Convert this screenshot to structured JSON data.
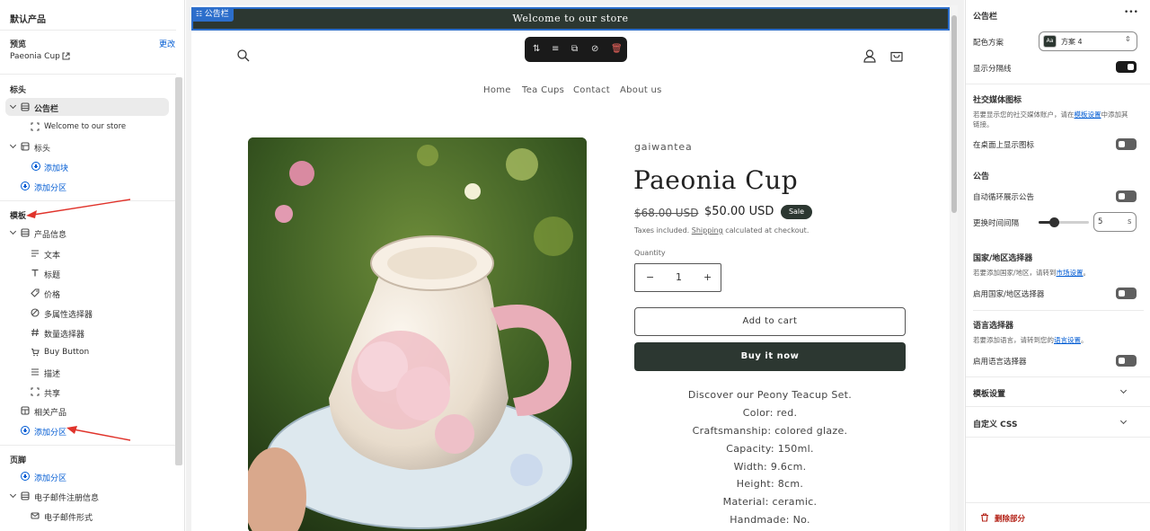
{
  "left": {
    "default_product": "默认产品",
    "preview_label": "预览",
    "change_link": "更改",
    "product_name": "Paeonia Cup",
    "header_section": "标头",
    "announcement_bar": "公告栏",
    "announcement_item": "Welcome to our store",
    "header_item": "标头",
    "add_block": "添加块",
    "add_section": "添加分区",
    "template_section": "模板",
    "product_info": "产品信息",
    "blocks": [
      "文本",
      "标题",
      "价格",
      "多属性选择器",
      "数量选择器",
      "Buy Button",
      "描述",
      "共享"
    ],
    "related_products": "相关产品",
    "add_section_2": "添加分区",
    "footer_section": "页脚",
    "add_section_3": "添加分区",
    "email_signup": "电子邮件注册信息",
    "email_form": "电子邮件形式"
  },
  "preview": {
    "announcement_tag": "公告栏",
    "announcement_text": "Welcome to our store",
    "nav": [
      "Home",
      "Tea Cups",
      "Contact",
      "About us"
    ],
    "vendor": "gaiwantea",
    "title": "Paeonia Cup",
    "old_price": "$68.00 USD",
    "new_price": "$50.00 USD",
    "sale_badge": "Sale",
    "taxes_prefix": "Taxes included.",
    "shipping_link": "Shipping",
    "taxes_suffix": "calculated at checkout.",
    "quantity_label": "Quantity",
    "quantity_value": "1",
    "add_to_cart": "Add to cart",
    "buy_now": "Buy it now",
    "description": [
      "Discover our Peony Teacup Set.",
      "Color: red.",
      "Craftsmanship: colored glaze.",
      "Capacity: 150ml.",
      "Width: 9.6cm.",
      "Height: 8cm.",
      "Material: ceramic.",
      "Handmade: No."
    ]
  },
  "right": {
    "title": "公告栏",
    "more": "•••",
    "color_scheme_label": "配色方案",
    "color_scheme_value": "方案 4",
    "swatch_text": "Aa",
    "show_divider": "显示分隔线",
    "social_heading": "社交媒体图标",
    "social_help_1": "若要显示您的社交媒体账户，请在",
    "social_help_link": "模板设置",
    "social_help_2": "中添加其",
    "social_help_3": "链接。",
    "show_on_desktop": "在桌面上显示图标",
    "announcement_heading": "公告",
    "auto_rotate": "自动循环展示公告",
    "change_interval": "更换时间间隔",
    "interval_value": "5",
    "interval_unit": "s",
    "interval_fraction": 0.3,
    "country_heading": "国家/地区选择器",
    "country_help": "若要添加国家/地区，请转到",
    "country_help_link": "市场设置",
    "country_help_end": "。",
    "enable_country": "启用国家/地区选择器",
    "language_heading": "语言选择器",
    "language_help": "若要添加语言，请转到您的",
    "language_help_link": "语言设置",
    "language_help_end": "。",
    "enable_language": "启用语言选择器",
    "template_settings": "模板设置",
    "custom_css": "自定义 CSS",
    "delete_section": "删除部分"
  },
  "colors": {
    "accent_blue": "#005bd3",
    "announcement_bg": "#2c3731",
    "selection_outline": "#2c6ecb",
    "danger": "#b42318"
  }
}
